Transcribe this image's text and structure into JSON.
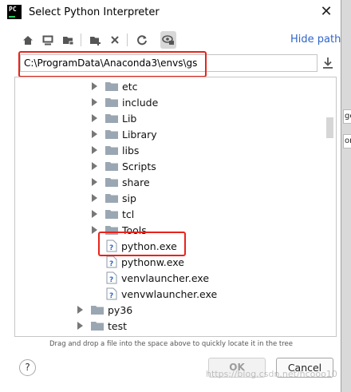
{
  "window": {
    "title": "Select Python Interpreter",
    "app_icon_text": "PC"
  },
  "toolbar": {
    "buttons": [
      "home-icon",
      "desktop-icon",
      "project-icon",
      "new-folder-icon",
      "delete-icon",
      "refresh-icon",
      "show-hidden-icon"
    ],
    "hide_path_label": "Hide path"
  },
  "path": {
    "value": "C:\\ProgramData\\Anaconda3\\envs\\gs"
  },
  "tree": {
    "items": [
      {
        "label": "etc",
        "type": "folder"
      },
      {
        "label": "include",
        "type": "folder"
      },
      {
        "label": "Lib",
        "type": "folder"
      },
      {
        "label": "Library",
        "type": "folder"
      },
      {
        "label": "libs",
        "type": "folder"
      },
      {
        "label": "Scripts",
        "type": "folder"
      },
      {
        "label": "share",
        "type": "folder"
      },
      {
        "label": "sip",
        "type": "folder"
      },
      {
        "label": "tcl",
        "type": "folder"
      },
      {
        "label": "Tools",
        "type": "folder"
      },
      {
        "label": "python.exe",
        "type": "file",
        "selected_highlight": true
      },
      {
        "label": "pythonw.exe",
        "type": "file"
      },
      {
        "label": "venvlauncher.exe",
        "type": "file"
      },
      {
        "label": "venvwlauncher.exe",
        "type": "file"
      },
      {
        "label": "py36",
        "type": "folder"
      },
      {
        "label": "test",
        "type": "folder"
      }
    ]
  },
  "hint": "Drag and drop a file into the space above to quickly locate it in the tree",
  "buttons": {
    "help": "?",
    "ok": "OK",
    "cancel": "Cancel"
  },
  "watermark": "https://blog.csdn.net/hcooo10",
  "background_fragments": [
    "ge",
    "or"
  ],
  "colors": {
    "link": "#2f65ca",
    "highlight_box": "#e8231b",
    "folder": "#9aa7b2"
  }
}
